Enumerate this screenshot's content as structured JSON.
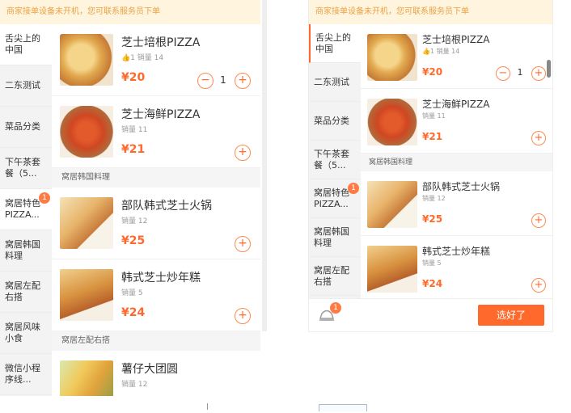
{
  "notice_text": "商家接单设备未开机，您可联系服务员下单",
  "left": {
    "categories": [
      {
        "label": "舌尖上的中国",
        "badge": ""
      },
      {
        "label": "二东测试",
        "badge": ""
      },
      {
        "label": "菜品分类",
        "badge": ""
      },
      {
        "label": "下午茶套餐（5...",
        "badge": ""
      },
      {
        "label": "窝居特色PIZZA...",
        "badge": "1"
      },
      {
        "label": "窝居韩国料理",
        "badge": ""
      },
      {
        "label": "窝居左配右搭",
        "badge": ""
      },
      {
        "label": "窝居风味小食",
        "badge": ""
      },
      {
        "label": "微信小程序线...",
        "badge": ""
      }
    ],
    "dishes_top": [
      {
        "name": "芝士培根PIZZA",
        "sales": "👍1 销量 14",
        "price": "¥20",
        "qty": "1"
      },
      {
        "name": "芝士海鲜PIZZA",
        "sales": "销量 11",
        "price": "¥21"
      }
    ],
    "section_korean": "窝居韩国料理",
    "dishes_korean": [
      {
        "name": "部队韩式芝士火锅",
        "sales": "销量 12",
        "price": "¥25"
      },
      {
        "name": "韩式芝士炒年糕",
        "sales": "销量 5",
        "price": "¥24"
      }
    ],
    "section_mix": "窝居左配右搭",
    "dishes_mix": [
      {
        "name": "薯仔大团圆",
        "sales": "销量 12"
      }
    ]
  },
  "right": {
    "categories": [
      {
        "label": "舌尖上的中国",
        "badge": ""
      },
      {
        "label": "二东测试",
        "badge": ""
      },
      {
        "label": "菜品分类",
        "badge": ""
      },
      {
        "label": "下午茶套餐（5...",
        "badge": ""
      },
      {
        "label": "窝居特色PIZZA...",
        "badge": "1"
      },
      {
        "label": "窝居韩国料理",
        "badge": ""
      },
      {
        "label": "窝居左配右搭",
        "badge": ""
      }
    ],
    "dishes_top": [
      {
        "name": "芝士培根PIZZA",
        "sales": "👍1 销量 14",
        "price": "¥20",
        "qty": "1"
      },
      {
        "name": "芝士海鲜PIZZA",
        "sales": "销量 11",
        "price": "¥21"
      }
    ],
    "section_korean": "窝居韩国料理",
    "dishes_korean": [
      {
        "name": "部队韩式芝士火锅",
        "sales": "销量 12",
        "price": "¥25"
      },
      {
        "name": "韩式芝士炒年糕",
        "sales": "销量 5",
        "price": "¥24"
      }
    ],
    "cart_badge": "1",
    "done_label": "选好了"
  },
  "symbols": {
    "plus": "+",
    "minus": "−"
  },
  "colors": {
    "accent": "#ff6a2c",
    "notice_bg": "#fff4dd",
    "notice_text": "#e8a347"
  }
}
